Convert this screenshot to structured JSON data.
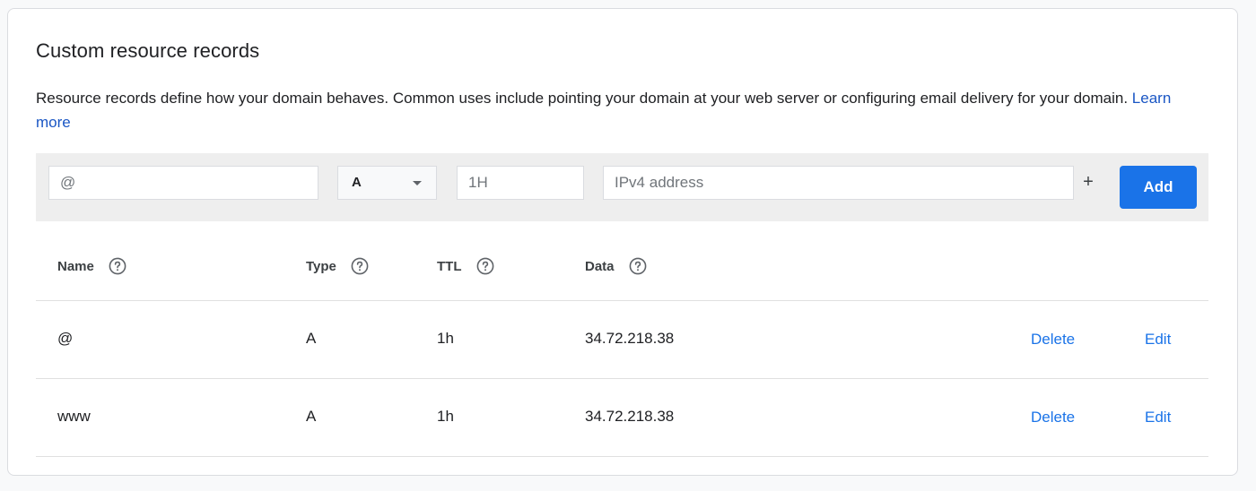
{
  "card": {
    "title": "Custom resource records",
    "description": "Resource records define how your domain behaves. Common uses include pointing your domain at your web server or configuring email delivery for your domain.",
    "learn_more": "Learn more"
  },
  "entry": {
    "name_value": "@",
    "type_value": "A",
    "ttl_placeholder": "1H",
    "data_placeholder": "IPv4 address",
    "plus_label": "+",
    "add_label": "Add"
  },
  "table": {
    "headers": [
      "Name",
      "Type",
      "TTL",
      "Data"
    ],
    "rows": [
      {
        "name": "@",
        "type": "A",
        "ttl": "1h",
        "data": "34.72.218.38",
        "delete": "Delete",
        "edit": "Edit"
      },
      {
        "name": "www",
        "type": "A",
        "ttl": "1h",
        "data": "34.72.218.38",
        "delete": "Delete",
        "edit": "Edit"
      }
    ]
  },
  "colors": {
    "accent": "#1a73e8",
    "link": "#1a56c4",
    "entry_bar": "#eeeeee",
    "divider": "#e0e0e0"
  }
}
